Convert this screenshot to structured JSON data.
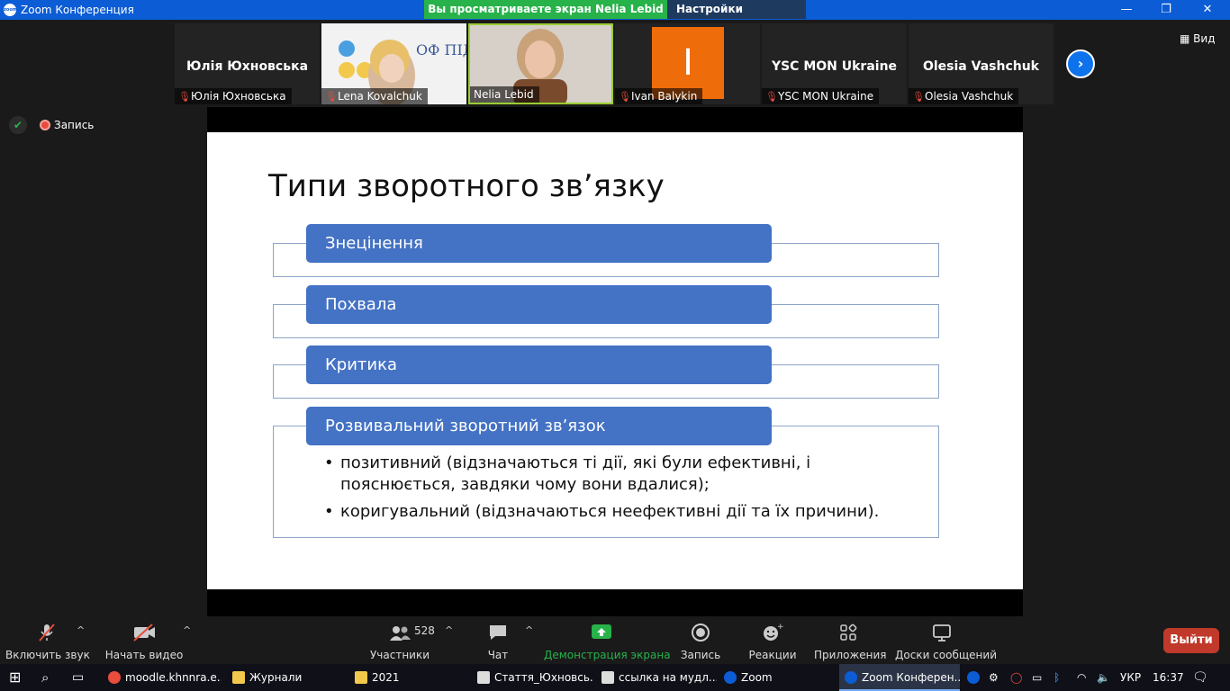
{
  "titlebar": {
    "title": "Zoom Конференция",
    "icon_text": "zoom",
    "minimize": "—",
    "maximize": "❐",
    "close": "✕"
  },
  "share_banner": "Вы просматриваете экран Nelia Lebid",
  "view_settings": "Настройки просмотра",
  "view_settings_caret": "⌄",
  "view_button": "Вид",
  "participants": [
    {
      "big_name": "Юлія Юхновська",
      "label": "Юлія Юхновська"
    },
    {
      "big_name": "",
      "label": "Lena Kovalchuk",
      "logo_text": "ОФ ПІДТРИМКИ"
    },
    {
      "big_name": "",
      "label": "Nelia Lebid"
    },
    {
      "big_name": "",
      "label": "Ivan Balykin",
      "avatar_letter": "I"
    },
    {
      "big_name": "YSC MON Ukraine",
      "label": "YSC MON Ukraine"
    },
    {
      "big_name": "Olesia Vashchuk",
      "label": "Olesia Vashchuk"
    }
  ],
  "next_arrow": "›",
  "recording_label": "Запись",
  "slide": {
    "title": "Типи зворотного зв’язку",
    "items": [
      "Знецінення",
      "Похвала",
      "Критика",
      "Розвивальний зворотний зв’язок"
    ],
    "bullets": [
      "позитивний (відзначаються ті дії, які були ефективні, і пояснюється, завдяки чому вони вдалися);",
      "коригувальний (відзначаються неефективні дії та їх причини)."
    ]
  },
  "toolbar": {
    "unmute": "Включить звук",
    "start_video": "Начать видео",
    "participants": "Участники",
    "participants_count": "528",
    "chat": "Чат",
    "share": "Демонстрация экрана",
    "record": "Запись",
    "reactions": "Реакции",
    "apps": "Приложения",
    "whiteboards": "Доски сообщений",
    "leave": "Выйти"
  },
  "taskbar": {
    "tasks": [
      "moodle.khnnra.e...",
      "Журнали",
      "2021",
      "Стаття_Юхновсь...",
      "ссылка на мудл....",
      "Zoom",
      "Zoom Конферен..."
    ],
    "lang": "УКР",
    "time": "16:37"
  },
  "colors": {
    "zoom_blue": "#0b5cd5",
    "share_green": "#27b24a",
    "slide_pill": "#4472c4",
    "leave_red": "#c0392b"
  }
}
